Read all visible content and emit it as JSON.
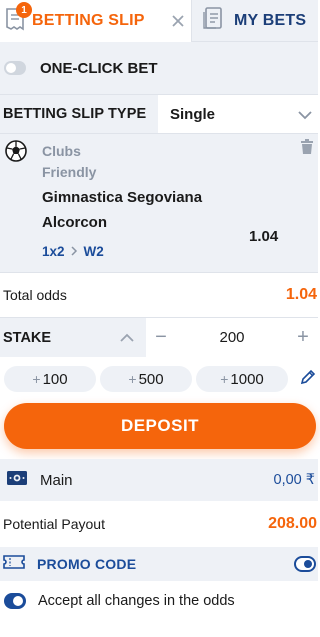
{
  "tabs": {
    "betting_slip": {
      "label": "BETTING SLIP",
      "badge": "1"
    },
    "my_bets": {
      "label": "MY BETS"
    }
  },
  "one_click": {
    "label": "ONE-CLICK BET",
    "enabled": false
  },
  "slip_type": {
    "label": "BETTING SLIP TYPE",
    "selected": "Single"
  },
  "bet": {
    "sport": "Clubs",
    "league": "Friendly",
    "team1": "Gimnastica Segoviana",
    "team2": "Alcorcon",
    "market": "1x2",
    "outcome": "W2",
    "odd": "1.04"
  },
  "total_odds": {
    "label": "Total odds",
    "value": "1.04"
  },
  "stake": {
    "label": "STAKE",
    "value": "200",
    "minus": "−",
    "plus": "+"
  },
  "quick_amounts": [
    {
      "plus": "+",
      "amount": "100"
    },
    {
      "plus": "+",
      "amount": "500"
    },
    {
      "plus": "+",
      "amount": "1000"
    }
  ],
  "deposit": {
    "label": "DEPOSIT"
  },
  "account": {
    "label": "Main",
    "balance": "0,00 ₹"
  },
  "payout": {
    "label": "Potential Payout",
    "value": "208.00"
  },
  "promo": {
    "label": "PROMO CODE"
  },
  "accept_changes": {
    "label": "Accept all changes in the odds",
    "enabled": true
  },
  "colors": {
    "accent": "#f5650c",
    "primary_blue": "#1b4c9a",
    "panel_bg": "#eef1f6",
    "muted": "#8a94a3"
  },
  "icons": {
    "slip": "receipt-icon",
    "close": "close-icon",
    "my_bets": "document-list-icon",
    "sport": "soccer-ball-icon",
    "delete": "trash-icon",
    "select": "chevron-down-icon",
    "stake_toggle": "chevron-up-icon",
    "edit": "pencil-icon",
    "wallet": "wallet-icon",
    "promo": "ticket-icon"
  }
}
